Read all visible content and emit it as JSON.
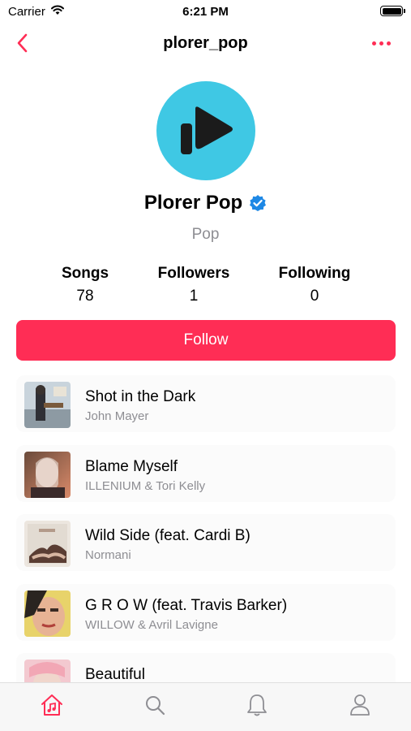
{
  "status_bar": {
    "carrier": "Carrier",
    "time": "6:21 PM"
  },
  "nav": {
    "title": "plorer_pop",
    "back_icon": "chevron-left-icon",
    "more_icon": "ellipsis-icon",
    "accent": "#ff2d55"
  },
  "profile": {
    "name": "Plorer Pop",
    "genre": "Pop",
    "verified": true,
    "avatar_color": "#3fc8e4",
    "stats": {
      "songs_label": "Songs",
      "songs_value": "78",
      "followers_label": "Followers",
      "followers_value": "1",
      "following_label": "Following",
      "following_value": "0"
    },
    "follow_label": "Follow"
  },
  "songs": [
    {
      "title": "Shot in the Dark",
      "artist": "John Mayer"
    },
    {
      "title": "Blame Myself",
      "artist": "ILLENIUM & Tori Kelly"
    },
    {
      "title": "Wild Side (feat. Cardi B)",
      "artist": "Normani"
    },
    {
      "title": "G R O W (feat. Travis Barker)",
      "artist": "WILLOW & Avril Lavigne"
    },
    {
      "title": "Beautiful",
      "artist": ""
    }
  ],
  "tab_bar": {
    "tabs": [
      {
        "icon": "home-music-icon",
        "active": true
      },
      {
        "icon": "search-icon",
        "active": false
      },
      {
        "icon": "bell-icon",
        "active": false
      },
      {
        "icon": "person-icon",
        "active": false
      }
    ]
  }
}
